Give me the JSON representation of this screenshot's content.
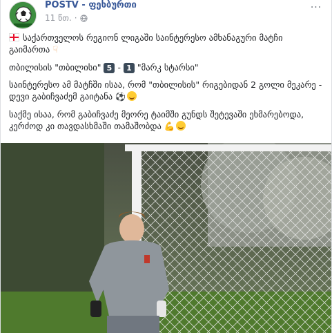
{
  "post": {
    "page_name": "POSTV - ფეხბურთი",
    "time": "11 წთ.",
    "more_label": "···",
    "paragraphs": {
      "p1": "საქართველოს რეგიონ ლიგაში საინტერესო ამხანაგური მატჩი გაიმართა",
      "p2_team1": "თბილისის \"თბილისი\"",
      "p2_score1": "5",
      "p2_dash": "-",
      "p2_score2": "1",
      "p2_team2": "\"მარკ სტარსი\"",
      "p3": "საინტერესო ამ მატჩში ისაა, რომ \"თბილისის\" რიგებიდან 2 გოლი მეკარე - დევი გაბიჩვაძემ გაიტანა",
      "p4": "საქმე ისაა, რომ გაბიჩვაძე მეორე ტაიმში გუნდს შეტევაში ეხმარებოდა, კერძოდ კი თავდასხმაში თამაშობდა"
    },
    "icons": {
      "avatar": "soccer-ball-logo",
      "privacy": "globe-icon",
      "flag": "georgia-flag-icon",
      "hand": "pointing-down-hand-icon",
      "ball": "soccer-ball-icon",
      "smile": "grinning-face-icon",
      "muscle": "flexed-biceps-icon"
    },
    "colors": {
      "page_name": "#385898",
      "meta_text": "#90949c",
      "score_box": "#3b4a59"
    }
  }
}
